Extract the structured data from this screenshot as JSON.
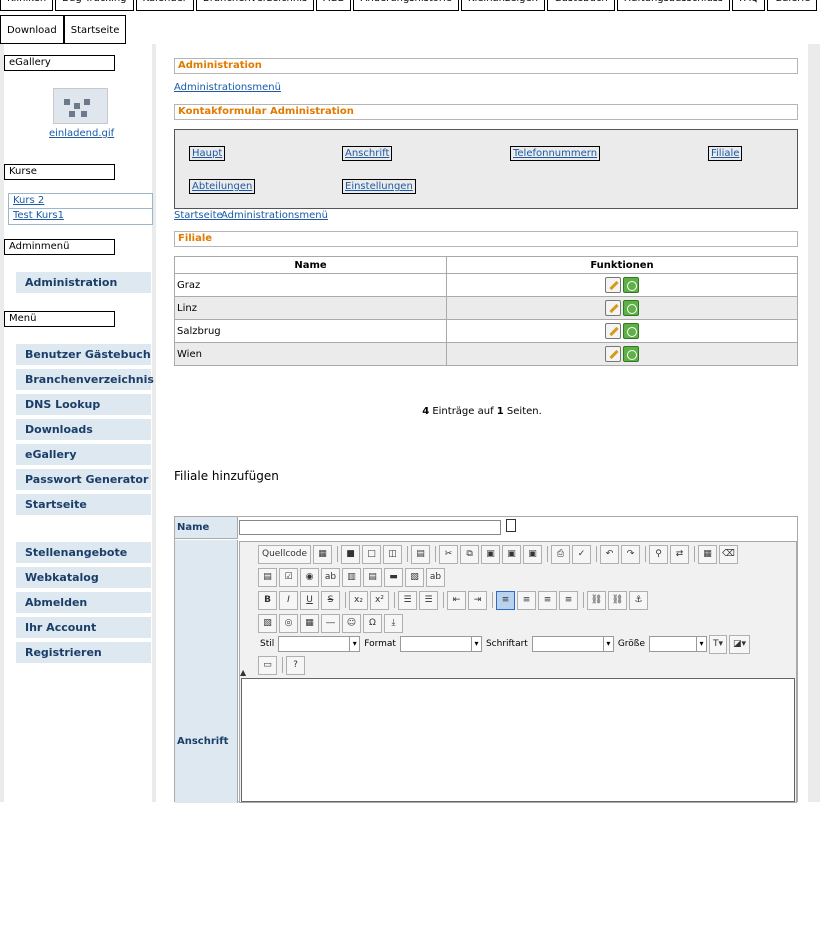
{
  "topnav": {
    "row1": [
      "Kliniken",
      "Bug Tracking",
      "Kalender",
      "Branchenverzeichnis",
      "AGB",
      "Änderungshistorie",
      "Kleinanzeigen",
      "Gästebuch",
      "Haftungsausschluss",
      "FAQ",
      "Galerie"
    ],
    "row2": [
      "Download",
      "Startseite"
    ]
  },
  "sidebar": {
    "egallery_label": "eGallery",
    "thumb_link": "einladend.gif",
    "kurse_label": "Kurse",
    "kurse": [
      "Kurs 2",
      "Test Kurs1"
    ],
    "adminmenu_label": "Adminmenü",
    "admin_item": "Administration",
    "menu_label": "Menü",
    "menu_items": [
      "Benutzer Gästebuch",
      "Branchenverzeichnis",
      "DNS Lookup",
      "Downloads",
      "eGallery",
      "Passwort Generator",
      "Startseite"
    ],
    "menu_items2": [
      "Stellenangebote",
      "Webkatalog",
      "Abmelden",
      "Ihr Account",
      "Registrieren"
    ]
  },
  "main": {
    "admin_header": "Administration",
    "admin_menu_link": "Administrationsmenü",
    "contact_header": "Kontakformular Administration",
    "admin_buttons": [
      "Haupt",
      "Anschrift",
      "Telefonnummern",
      "Filiale",
      "Abteilungen",
      "Einstellungen"
    ],
    "crumb_start": "Startseite",
    "crumb_admin": "Administrationsmenü",
    "filiale_header": "Filiale",
    "table": {
      "headers": [
        "Name",
        "Funktionen"
      ],
      "rows": [
        "Graz",
        "Linz",
        "Salzbrug",
        "Wien"
      ]
    },
    "pager": {
      "count": "4",
      "text1": " Einträge auf ",
      "pages": "1",
      "text2": " Seiten."
    },
    "add_title": "Filiale hinzufügen",
    "form": {
      "name_label": "Name",
      "name_value": "",
      "address_label": "Anschrift"
    },
    "editor": {
      "source_label": "Quellcode",
      "stil_label": "Stil",
      "format_label": "Format",
      "font_label": "Schriftart",
      "size_label": "Größe"
    }
  }
}
